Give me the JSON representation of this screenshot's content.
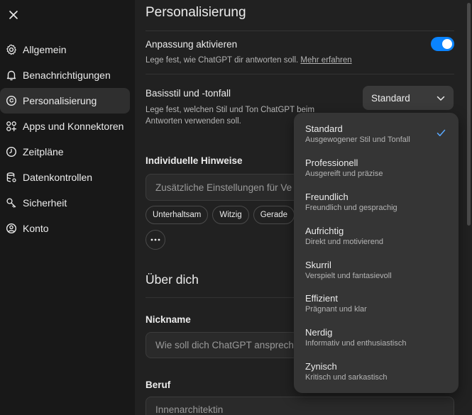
{
  "sidebar": {
    "items": [
      {
        "label": "Allgemein",
        "icon": "gear-icon"
      },
      {
        "label": "Benachrichtigungen",
        "icon": "bell-icon"
      },
      {
        "label": "Personalisierung",
        "icon": "personalize-icon"
      },
      {
        "label": "Apps und Konnektoren",
        "icon": "apps-icon"
      },
      {
        "label": "Zeitpläne",
        "icon": "clock-icon"
      },
      {
        "label": "Datenkontrollen",
        "icon": "database-icon"
      },
      {
        "label": "Sicherheit",
        "icon": "key-icon"
      },
      {
        "label": "Konto",
        "icon": "account-icon"
      }
    ],
    "active_index": 2
  },
  "main": {
    "title": "Personalisierung",
    "customization": {
      "title": "Anpassung aktivieren",
      "desc": "Lege fest, wie ChatGPT dir antworten soll.",
      "link": "Mehr erfahren",
      "enabled": true
    },
    "base_style": {
      "title": "Basisstil und -tonfall",
      "desc_line1": "Lege fest, welchen Stil und Ton ChatGPT beim",
      "desc_line2": "Antworten verwenden soll.",
      "selected": "Standard"
    },
    "custom_instructions": {
      "title": "Individuelle Hinweise",
      "placeholder": "Zusätzliche Einstellungen für Ve",
      "chips": [
        "Unterhaltsam",
        "Witzig",
        "Gerade"
      ]
    },
    "about": {
      "title": "Über dich",
      "nickname_label": "Nickname",
      "nickname_placeholder": "Wie soll dich ChatGPT ansprech",
      "job_label": "Beruf",
      "job_value": "Innenarchitektin"
    }
  },
  "dropdown": {
    "options": [
      {
        "title": "Standard",
        "desc": "Ausgewogener Stil und Tonfall",
        "selected": true
      },
      {
        "title": "Professionell",
        "desc": "Ausgereift und präzise"
      },
      {
        "title": "Freundlich",
        "desc": "Freundlich und gesprachig"
      },
      {
        "title": "Aufrichtig",
        "desc": "Direkt und motivierend"
      },
      {
        "title": "Skurril",
        "desc": "Verspielt und fantasievoll"
      },
      {
        "title": "Effizient",
        "desc": "Prägnant und klar"
      },
      {
        "title": "Nerdig",
        "desc": "Informativ und enthusiastisch"
      },
      {
        "title": "Zynisch",
        "desc": "Kritisch und sarkastisch"
      }
    ]
  },
  "colors": {
    "accent": "#0a84ff",
    "check": "#5aa9ff",
    "panel": "#212121",
    "sidebar": "#181818",
    "menu": "#353535"
  }
}
